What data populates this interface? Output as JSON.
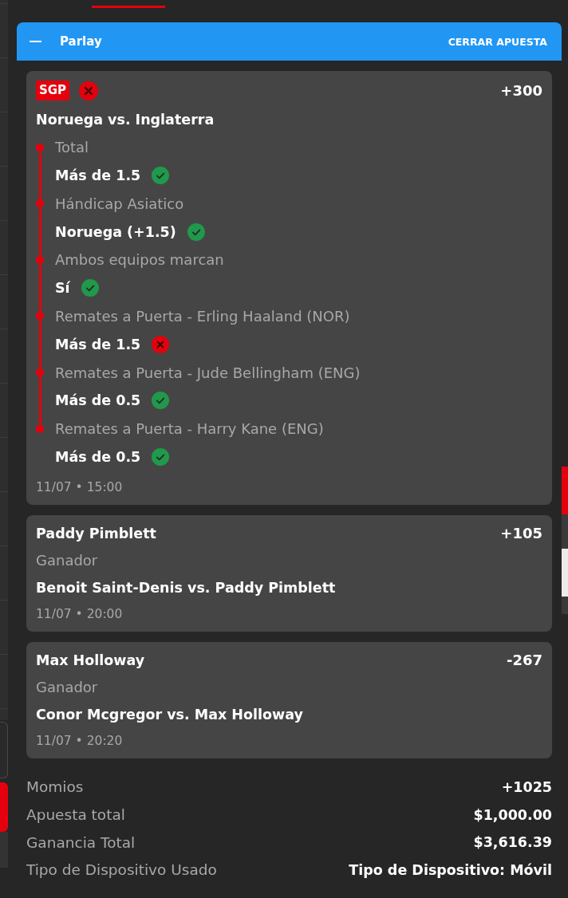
{
  "bet_slip": {
    "header": {
      "title": "Parlay",
      "close_label": "CERRAR APUESTA"
    },
    "legs": [
      {
        "kind": "sgp",
        "badge": "SGP",
        "won": false,
        "odds": "+300",
        "event": "Noruega vs. Inglaterra",
        "selections": [
          {
            "market": "Total",
            "pick": "Más de 1.5",
            "won": true
          },
          {
            "market": "Hándicap Asiatico",
            "pick": "Noruega (+1.5)",
            "won": true
          },
          {
            "market": "Ambos equipos marcan",
            "pick": "Sí",
            "won": true
          },
          {
            "market": "Remates a Puerta - Erling Haaland (NOR)",
            "pick": "Más de 1.5",
            "won": false
          },
          {
            "market": "Remates a Puerta - Jude Bellingham (ENG)",
            "pick": "Más de 0.5",
            "won": true
          },
          {
            "market": "Remates a Puerta - Harry Kane (ENG)",
            "pick": "Más de 0.5",
            "won": true
          }
        ],
        "date": "11/07 • 15:00"
      },
      {
        "kind": "single",
        "pick": "Paddy Pimblett",
        "odds": "+105",
        "market": "Ganador",
        "event": "Benoit Saint-Denis vs. Paddy Pimblett",
        "date": "11/07 • 20:00"
      },
      {
        "kind": "single",
        "pick": "Max Holloway",
        "odds": "-267",
        "market": "Ganador",
        "event": "Conor Mcgregor vs. Max Holloway",
        "date": "11/07 • 20:20"
      }
    ],
    "summary": [
      {
        "label": "Momios",
        "value": "+1025"
      },
      {
        "label": "Apuesta total",
        "value": "$1,000.00"
      },
      {
        "label": "Ganancia Total",
        "value": "$3,616.39"
      },
      {
        "label": "Tipo de Dispositivo Usado",
        "value": "Tipo de Dispositivo: Móvil"
      }
    ]
  }
}
